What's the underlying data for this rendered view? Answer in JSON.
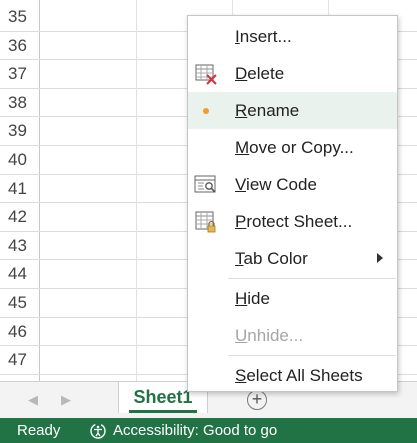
{
  "grid": {
    "row_numbers": [
      "35",
      "36",
      "37",
      "38",
      "39",
      "40",
      "41",
      "42",
      "43",
      "44",
      "45",
      "46",
      "47"
    ]
  },
  "tabs": {
    "active_sheet": "Sheet1",
    "add_sheet_symbol": "+"
  },
  "status": {
    "ready": "Ready",
    "accessibility": "Accessibility: Good to go"
  },
  "menu": {
    "items": [
      {
        "label": "Insert...",
        "mnemonic": "I",
        "rest": "nsert..."
      },
      {
        "label": "Delete",
        "mnemonic": "D",
        "rest": "elete"
      },
      {
        "label": "Rename",
        "mnemonic": "R",
        "rest": "ename"
      },
      {
        "label": "Move or Copy...",
        "mnemonic": "M",
        "rest": "ove or Copy..."
      },
      {
        "label": "View Code",
        "mnemonic": "V",
        "rest": "iew Code"
      },
      {
        "label": "Protect Sheet...",
        "mnemonic": "P",
        "rest": "rotect Sheet..."
      },
      {
        "label": "Tab Color",
        "mnemonic": "T",
        "rest": "ab Color"
      },
      {
        "label": "Hide",
        "mnemonic": "H",
        "rest": "ide"
      },
      {
        "label": "Unhide...",
        "mnemonic": "U",
        "rest": "nhide..."
      },
      {
        "label": "Select All Sheets",
        "mnemonic": "S",
        "rest": "elect All Sheets"
      }
    ]
  },
  "colors": {
    "excel_green": "#217346",
    "hover_bg": "#e9f2ec",
    "rename_dot": "#f39c2b",
    "delete_x": "#d13438"
  }
}
